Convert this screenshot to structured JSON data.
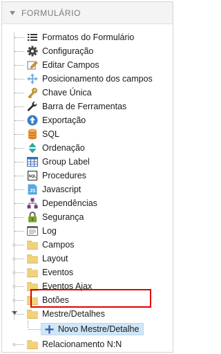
{
  "header": {
    "title": "FORMULÁRIO"
  },
  "tree": {
    "items": [
      {
        "label": "Formatos do Formulário",
        "icon": "list-icon"
      },
      {
        "label": "Configuração",
        "icon": "gear-icon"
      },
      {
        "label": "Editar Campos",
        "icon": "edit-icon"
      },
      {
        "label": "Posicionamento dos campos",
        "icon": "move-icon"
      },
      {
        "label": "Chave Única",
        "icon": "key-icon"
      },
      {
        "label": "Barra de Ferramentas",
        "icon": "wrench-icon"
      },
      {
        "label": "Exportação",
        "icon": "export-icon"
      },
      {
        "label": "SQL",
        "icon": "database-icon"
      },
      {
        "label": "Ordenação",
        "icon": "sort-icon"
      },
      {
        "label": "Group Label",
        "icon": "table-icon"
      },
      {
        "label": "Procedures",
        "icon": "sql-icon"
      },
      {
        "label": "Javascript",
        "icon": "js-icon"
      },
      {
        "label": "Dependências",
        "icon": "hierarchy-icon"
      },
      {
        "label": "Segurança",
        "icon": "lock-icon"
      },
      {
        "label": "Log",
        "icon": "log-icon"
      },
      {
        "label": "Campos",
        "icon": "folder-icon"
      },
      {
        "label": "Layout",
        "icon": "folder-icon"
      },
      {
        "label": "Eventos",
        "icon": "folder-icon"
      },
      {
        "label": "Eventos Ajax",
        "icon": "folder-icon"
      },
      {
        "label": "Botões",
        "icon": "folder-icon"
      },
      {
        "label": "Mestre/Detalhes",
        "icon": "folder-icon"
      },
      {
        "label": "Novo Mestre/Detalhe",
        "icon": "plus-icon"
      },
      {
        "label": "Relacionamento N:N",
        "icon": "folder-icon"
      }
    ]
  },
  "colors": {
    "highlight_border": "#e00000",
    "selection_bg": "#cfe6f7",
    "folder": "#f0d27c"
  }
}
